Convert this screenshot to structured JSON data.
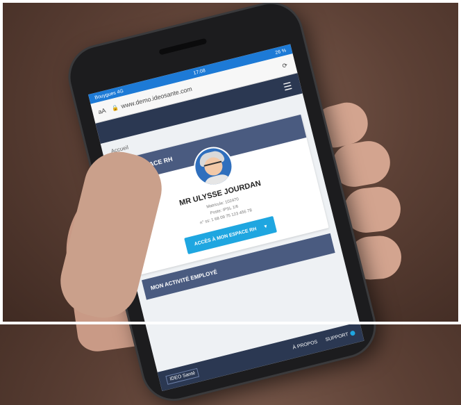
{
  "status_bar": {
    "carrier": "Bouygues",
    "network": "4G",
    "time": "17:08",
    "battery": "26 %"
  },
  "browser": {
    "text_size_label": "aA",
    "url": "www.demo.ideosante.com",
    "reload_icon": "reload-icon",
    "lock_icon": "lock-icon"
  },
  "site": {
    "menu_icon": "menu-icon",
    "breadcrumb": "Accueil"
  },
  "profile_card": {
    "title": "MON ESPACE RH",
    "name": "MR ULYSSE JOURDAN",
    "meta_line1": "Matricule: 102470",
    "meta_line2": "Poste: IPSL 1/6",
    "meta_line3": "n° ss: 1 68 09 75 123 456 78",
    "button_label": "ACCÈS À MON ESPACE RH",
    "button_caret": "▾"
  },
  "section": {
    "title": "MON ACTIVITÉ EMPLOYÉ"
  },
  "bottom_bar": {
    "left_label": "IDEO Santé",
    "about_label": "À PROPOS",
    "support_label": "SUPPORT"
  },
  "colors": {
    "header_blue": "#1d7ad6",
    "navy": "#2b3852",
    "card_head": "#4a5b80",
    "button": "#1fa6e0"
  }
}
